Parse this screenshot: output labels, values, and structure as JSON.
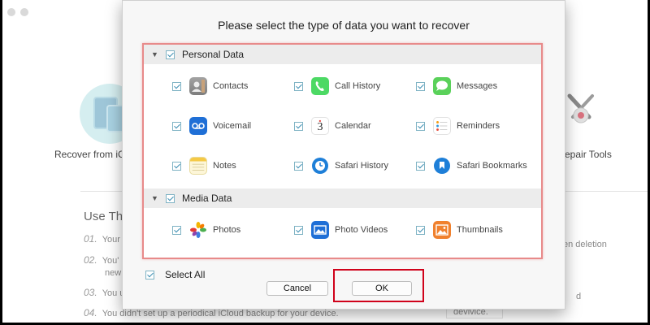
{
  "background": {
    "left_card_label": "Recover from iC",
    "right_card_label": "epair Tools",
    "use_title": "Use Thi",
    "items": [
      {
        "num": "01.",
        "text": "Your"
      },
      {
        "num": "02.",
        "text": "You'",
        "cont": "new"
      },
      {
        "num": "03.",
        "text": "You u"
      },
      {
        "num": "04.",
        "text": "You didn't set up a periodical iCloud backup for your device."
      }
    ],
    "right_texts": [
      "en deletion",
      "d",
      "devivice."
    ]
  },
  "dialog": {
    "title": "Please select the type of data you want to recover",
    "sections": [
      {
        "label": "Personal Data",
        "checked": true,
        "items": [
          {
            "label": "Contacts",
            "icon": "contacts-icon",
            "checked": true
          },
          {
            "label": "Call History",
            "icon": "phone-icon",
            "checked": true
          },
          {
            "label": "Messages",
            "icon": "messages-icon",
            "checked": true
          },
          {
            "label": "Voicemail",
            "icon": "voicemail-icon",
            "checked": true
          },
          {
            "label": "Calendar",
            "icon": "calendar-icon",
            "checked": true,
            "day": "3"
          },
          {
            "label": "Reminders",
            "icon": "reminders-icon",
            "checked": true
          },
          {
            "label": "Notes",
            "icon": "notes-icon",
            "checked": true
          },
          {
            "label": "Safari History",
            "icon": "safari-history-icon",
            "checked": true
          },
          {
            "label": "Safari Bookmarks",
            "icon": "safari-bookmarks-icon",
            "checked": true
          }
        ]
      },
      {
        "label": "Media Data",
        "checked": true,
        "items": [
          {
            "label": "Photos",
            "icon": "photos-icon",
            "checked": true
          },
          {
            "label": "Photo Videos",
            "icon": "photo-videos-icon",
            "checked": true
          },
          {
            "label": "Thumbnails",
            "icon": "thumbnails-icon",
            "checked": true
          }
        ]
      }
    ],
    "select_all_label": "Select All",
    "cancel_label": "Cancel",
    "ok_label": "OK"
  },
  "colors": {
    "panel_border": "#e88a8a",
    "ok_highlight": "#d0021b",
    "checkbox": "#3d8fb3"
  }
}
